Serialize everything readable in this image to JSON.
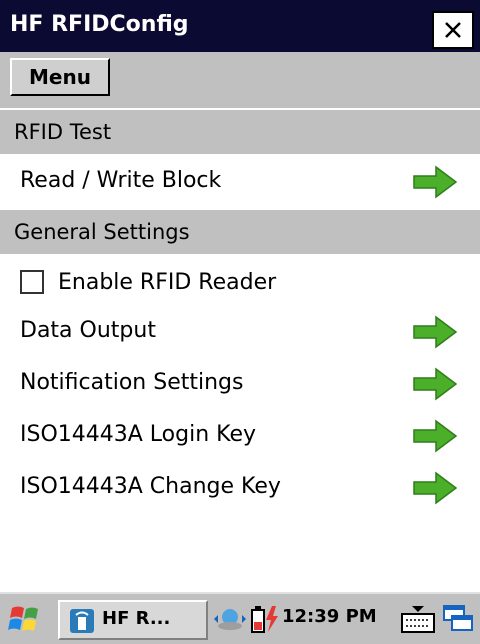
{
  "window": {
    "title": "HF RFIDConfig",
    "close_glyph": "✕"
  },
  "menubar": {
    "menu_label": "Menu"
  },
  "sections": [
    {
      "title": "RFID Test"
    },
    {
      "title": "General Settings"
    }
  ],
  "items": {
    "read_write_block": "Read / Write Block",
    "enable_rfid_reader": {
      "label": "Enable RFID Reader",
      "checked": false
    },
    "data_output": "Data Output",
    "notification_settings": "Notification Settings",
    "iso14443a_login_key": "ISO14443A Login Key",
    "iso14443a_change_key": "ISO14443A Change Key"
  },
  "taskbar": {
    "task_label": "HF R...",
    "time": "12:39 PM"
  },
  "colors": {
    "titlebar": "#0a0a33",
    "section": "#c0c0c0",
    "arrow": "#4caf2a"
  },
  "icons": [
    "windows-start-icon",
    "rfid-app-icon",
    "network-icon",
    "battery-charging-icon",
    "keyboard-icon",
    "switch-windows-icon",
    "right-arrow-icon",
    "close-icon"
  ]
}
